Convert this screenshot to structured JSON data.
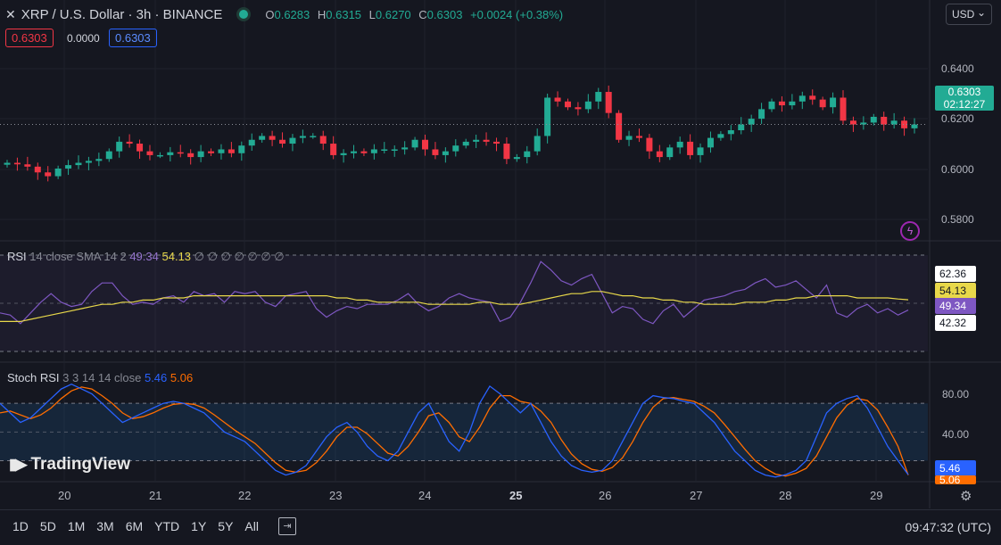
{
  "header": {
    "close_glyph": "✕",
    "title": "XRP / U.S. Dollar · 3h · BINANCE",
    "o_label": "O",
    "o_value": "0.6283",
    "h_label": "H",
    "h_value": "0.6315",
    "l_label": "L",
    "l_value": "0.6270",
    "c_label": "C",
    "c_value": "0.6303",
    "change": "+0.0024 (+0.38%)"
  },
  "bid_ask": {
    "sell": "0.6303",
    "spread": "0.0000",
    "buy": "0.6303"
  },
  "currency": {
    "label": "USD",
    "chevron": "⌄"
  },
  "price_axis": [
    "0.6400",
    "0.6200",
    "0.6000",
    "0.5800"
  ],
  "last_price": {
    "value": "0.6303",
    "countdown": "02:12:27"
  },
  "rsi": {
    "label": "RSI",
    "params": "14 close SMA 14 2",
    "value": "49.34",
    "sma": "54.13",
    "markers": "∅ ∅ ∅ ∅ ∅ ∅ ∅",
    "axis": [
      "62.36",
      "54.13",
      "49.34",
      "42.32"
    ]
  },
  "stoch": {
    "label": "Stoch RSI",
    "params": "3 3 14 14 close",
    "k": "5.46",
    "d": "5.06",
    "axis": [
      "80.00",
      "40.00"
    ],
    "tags": [
      "5.46",
      "5.06"
    ]
  },
  "time_axis": [
    "20",
    "21",
    "22",
    "23",
    "24",
    "25",
    "26",
    "27",
    "28",
    "29"
  ],
  "timeframes": [
    "1D",
    "5D",
    "1M",
    "3M",
    "6M",
    "YTD",
    "1Y",
    "5Y",
    "All"
  ],
  "clock": "09:47:32 (UTC)",
  "logo_text": "TradingView",
  "colors": {
    "up": "#22ab94",
    "down": "#f23645",
    "rsi": "#7e57c2",
    "rsi_sma": "#e8d84a",
    "k": "#2962ff",
    "d": "#ff6d00"
  },
  "chart_data": [
    {
      "type": "candlestick",
      "title": "XRP / U.S. Dollar · 3h · BINANCE",
      "x": [
        "20",
        "21",
        "22",
        "23",
        "24",
        "25",
        "26",
        "27",
        "28",
        "29"
      ],
      "ylim": [
        0.573,
        0.681
      ],
      "close": [
        0.61,
        0.6092,
        0.608,
        0.605,
        0.603,
        0.607,
        0.6088,
        0.61,
        0.611,
        0.612,
        0.616,
        0.621,
        0.62,
        0.616,
        0.614,
        0.614,
        0.6155,
        0.615,
        0.613,
        0.616,
        0.615,
        0.617,
        0.615,
        0.619,
        0.622,
        0.624,
        0.622,
        0.62,
        0.623,
        0.624,
        0.624,
        0.62,
        0.614,
        0.615,
        0.616,
        0.615,
        0.617,
        0.617,
        0.617,
        0.618,
        0.622,
        0.617,
        0.614,
        0.616,
        0.619,
        0.621,
        0.622,
        0.621,
        0.62,
        0.612,
        0.613,
        0.616,
        0.624,
        0.644,
        0.642,
        0.639,
        0.638,
        0.642,
        0.647,
        0.636,
        0.622,
        0.624,
        0.623,
        0.616,
        0.613,
        0.618,
        0.621,
        0.614,
        0.618,
        0.623,
        0.625,
        0.627,
        0.63,
        0.633,
        0.638,
        0.642,
        0.64,
        0.642,
        0.645,
        0.643,
        0.639,
        0.644,
        0.632,
        0.63,
        0.631,
        0.634,
        0.63,
        0.632,
        0.628,
        0.63
      ]
    },
    {
      "type": "line",
      "name": "RSI",
      "ylim": [
        30,
        75
      ],
      "series": [
        {
          "name": "RSI",
          "values": [
            48,
            47,
            43,
            48,
            53,
            57,
            53,
            51,
            52,
            58,
            62,
            62,
            56,
            52,
            53,
            52,
            55,
            56,
            53,
            58,
            56,
            57,
            53,
            58,
            57,
            58,
            53,
            51,
            56,
            57,
            58,
            50,
            46,
            49,
            51,
            50,
            52,
            52,
            52,
            54,
            57,
            52,
            49,
            51,
            55,
            57,
            55,
            54,
            53,
            44,
            46,
            53,
            62,
            72,
            68,
            63,
            61,
            64,
            66,
            57,
            48,
            51,
            50,
            45,
            43,
            49,
            52,
            46,
            50,
            54,
            55,
            56,
            58,
            59,
            62,
            64,
            60,
            61,
            63,
            59,
            55,
            61,
            48,
            46,
            50,
            52,
            48,
            50,
            47,
            49.34
          ]
        },
        {
          "name": "SMA",
          "values": [
            44,
            44,
            44,
            45,
            46,
            47,
            48,
            49,
            50,
            51,
            52,
            52,
            53,
            53,
            54,
            54,
            55,
            55,
            55,
            56,
            56,
            56,
            56,
            56,
            56,
            56,
            56,
            56,
            56,
            56,
            56,
            56,
            56,
            55,
            55,
            54,
            54,
            53,
            53,
            53,
            53,
            53,
            52,
            52,
            52,
            52,
            52,
            53,
            53,
            52,
            52,
            52,
            53,
            54,
            55,
            56,
            57,
            57,
            58,
            58,
            57,
            56,
            56,
            55,
            55,
            54,
            54,
            53,
            53,
            52,
            52,
            52,
            52,
            53,
            53,
            53,
            54,
            54,
            55,
            55,
            56,
            56,
            56,
            56,
            55,
            55,
            55,
            55,
            54.5,
            54.13
          ]
        }
      ]
    },
    {
      "type": "line",
      "name": "Stoch RSI",
      "ylim": [
        0,
        110
      ],
      "series": [
        {
          "name": "K",
          "values": [
            80,
            70,
            60,
            65,
            75,
            85,
            95,
            100,
            95,
            90,
            80,
            70,
            60,
            65,
            70,
            75,
            80,
            82,
            80,
            75,
            70,
            60,
            50,
            45,
            40,
            30,
            20,
            10,
            5,
            8,
            15,
            30,
            45,
            55,
            60,
            50,
            35,
            25,
            20,
            30,
            50,
            70,
            80,
            60,
            40,
            30,
            50,
            80,
            98,
            90,
            80,
            70,
            80,
            60,
            40,
            25,
            15,
            10,
            8,
            10,
            20,
            40,
            60,
            80,
            88,
            86,
            85,
            82,
            80,
            70,
            60,
            45,
            30,
            20,
            10,
            5,
            3,
            5.46,
            10,
            20,
            45,
            70,
            80,
            85,
            88,
            75,
            55,
            35,
            20,
            5.46
          ]
        },
        {
          "name": "D",
          "values": [
            70,
            72,
            68,
            64,
            68,
            75,
            85,
            93,
            97,
            95,
            88,
            80,
            70,
            64,
            66,
            70,
            75,
            79,
            80,
            79,
            75,
            68,
            60,
            52,
            45,
            38,
            28,
            18,
            10,
            8,
            10,
            18,
            30,
            45,
            55,
            55,
            48,
            38,
            28,
            25,
            35,
            50,
            67,
            70,
            60,
            45,
            40,
            55,
            75,
            88,
            88,
            82,
            80,
            72,
            60,
            42,
            27,
            17,
            11,
            9,
            13,
            23,
            40,
            60,
            76,
            85,
            86,
            84,
            82,
            77,
            70,
            58,
            45,
            32,
            20,
            12,
            6,
            4,
            7,
            12,
            25,
            45,
            65,
            78,
            85,
            83,
            73,
            55,
            35,
            5.06
          ]
        }
      ]
    }
  ]
}
